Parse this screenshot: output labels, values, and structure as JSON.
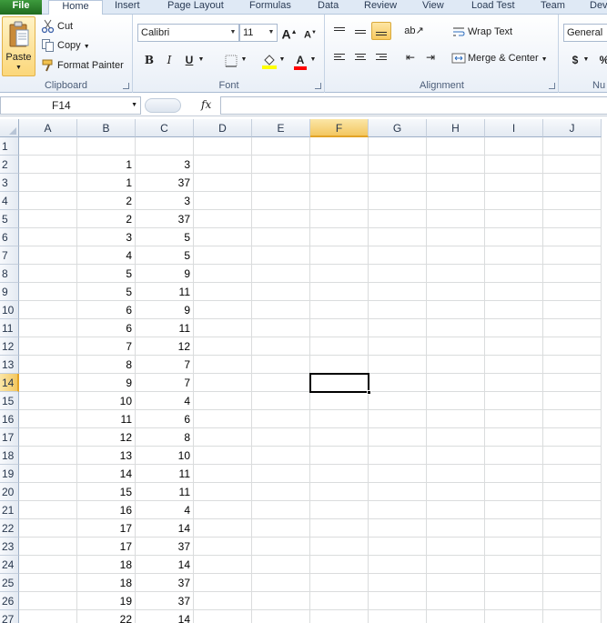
{
  "tabs": [
    "File",
    "Home",
    "Insert",
    "Page Layout",
    "Formulas",
    "Data",
    "Review",
    "View",
    "Load Test",
    "Team",
    "Deve"
  ],
  "active_tab": "Home",
  "clipboard": {
    "group_label": "Clipboard",
    "paste": "Paste",
    "cut": "Cut",
    "copy": "Copy",
    "format_painter": "Format Painter"
  },
  "font": {
    "group_label": "Font",
    "name": "Calibri",
    "size": "11",
    "bold": "B",
    "italic": "I",
    "underline": "U",
    "grow": "A",
    "shrink": "A",
    "font_color_letter": "A",
    "fill_color": "#ffff00",
    "text_color": "#ff0000"
  },
  "alignment": {
    "group_label": "Alignment",
    "wrap_text": "Wrap Text",
    "merge_center": "Merge & Center"
  },
  "number": {
    "group_label": "Nu",
    "format": "General",
    "currency": "$",
    "percent": "%"
  },
  "namebox": "F14",
  "fx": "fx",
  "columns": [
    "A",
    "B",
    "C",
    "D",
    "E",
    "F",
    "G",
    "H",
    "I",
    "J"
  ],
  "selected_column": "F",
  "selected_row": "14",
  "rows": [
    {
      "n": "1",
      "b": "",
      "c": ""
    },
    {
      "n": "2",
      "b": "1",
      "c": "3"
    },
    {
      "n": "3",
      "b": "1",
      "c": "37"
    },
    {
      "n": "4",
      "b": "2",
      "c": "3"
    },
    {
      "n": "5",
      "b": "2",
      "c": "37"
    },
    {
      "n": "6",
      "b": "3",
      "c": "5"
    },
    {
      "n": "7",
      "b": "4",
      "c": "5"
    },
    {
      "n": "8",
      "b": "5",
      "c": "9"
    },
    {
      "n": "9",
      "b": "5",
      "c": "11"
    },
    {
      "n": "10",
      "b": "6",
      "c": "9"
    },
    {
      "n": "11",
      "b": "6",
      "c": "11"
    },
    {
      "n": "12",
      "b": "7",
      "c": "12"
    },
    {
      "n": "13",
      "b": "8",
      "c": "7"
    },
    {
      "n": "14",
      "b": "9",
      "c": "7"
    },
    {
      "n": "15",
      "b": "10",
      "c": "4"
    },
    {
      "n": "16",
      "b": "11",
      "c": "6"
    },
    {
      "n": "17",
      "b": "12",
      "c": "8"
    },
    {
      "n": "18",
      "b": "13",
      "c": "10"
    },
    {
      "n": "19",
      "b": "14",
      "c": "11"
    },
    {
      "n": "20",
      "b": "15",
      "c": "11"
    },
    {
      "n": "21",
      "b": "16",
      "c": "4"
    },
    {
      "n": "22",
      "b": "17",
      "c": "14"
    },
    {
      "n": "23",
      "b": "17",
      "c": "37"
    },
    {
      "n": "24",
      "b": "18",
      "c": "14"
    },
    {
      "n": "25",
      "b": "18",
      "c": "37"
    },
    {
      "n": "26",
      "b": "19",
      "c": "37"
    },
    {
      "n": "27",
      "b": "22",
      "c": "14"
    }
  ]
}
